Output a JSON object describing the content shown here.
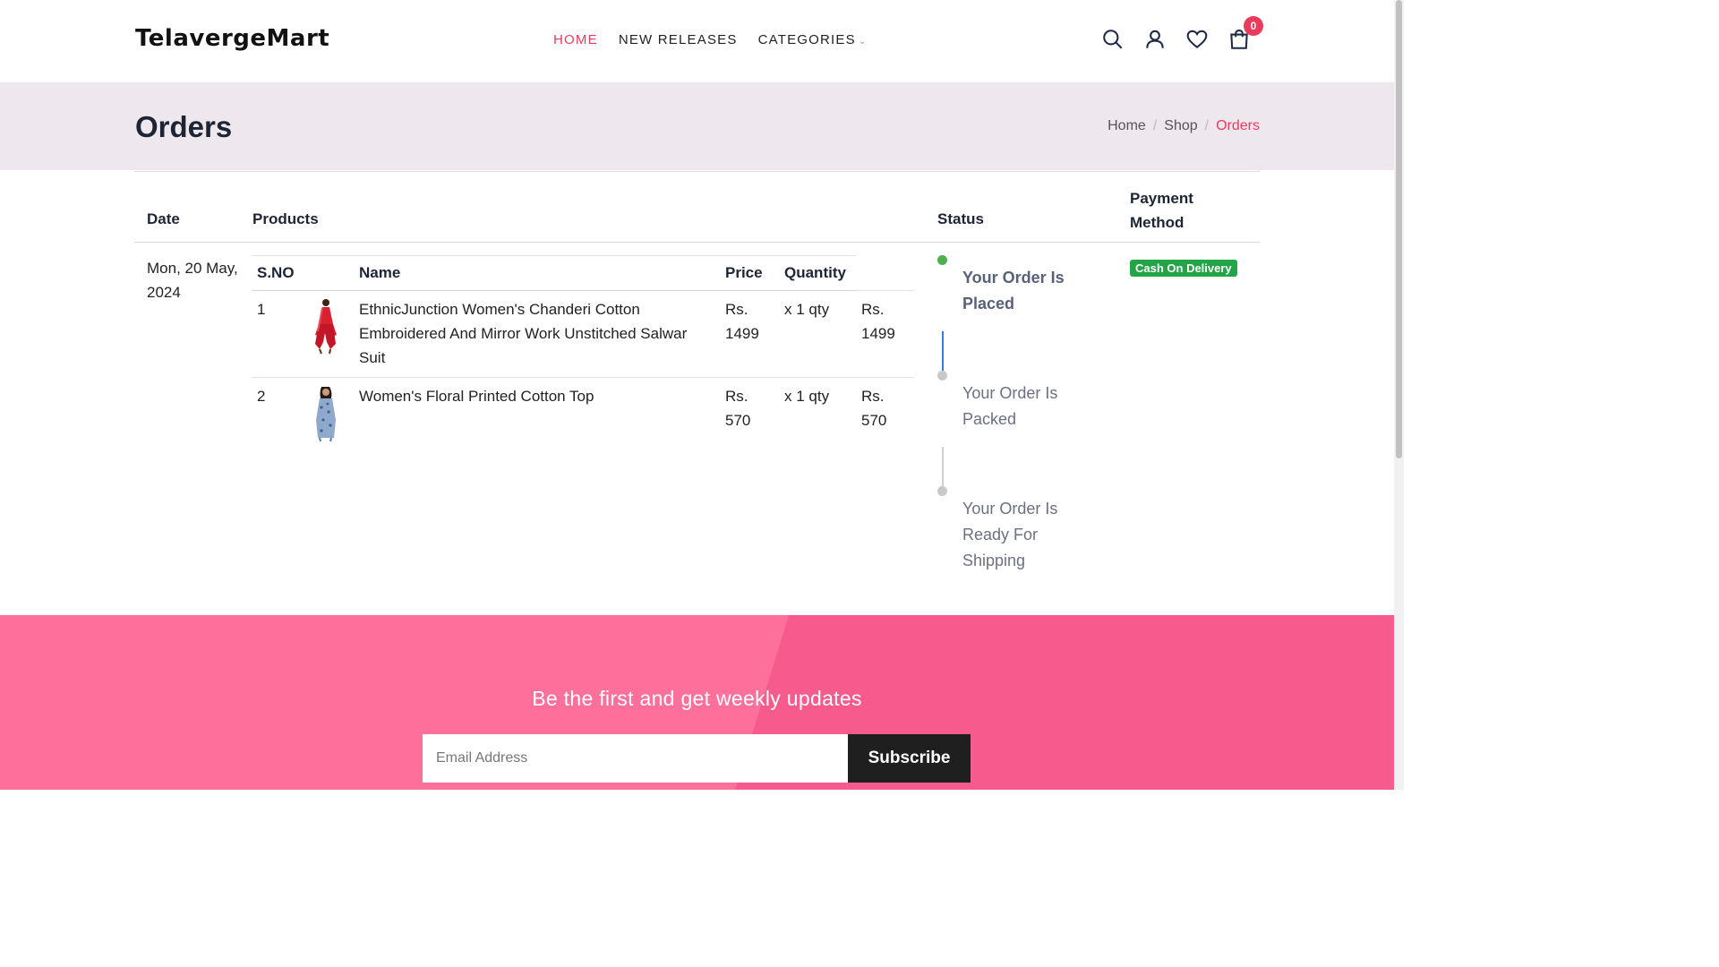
{
  "brand": {
    "logo": "TelavergeMart"
  },
  "nav": {
    "items": [
      {
        "label": "HOME",
        "active": true
      },
      {
        "label": "NEW RELEASES",
        "active": false
      },
      {
        "label": "CATEGORIES",
        "active": false
      }
    ],
    "chevron": "⌄"
  },
  "header_icons": {
    "search": "search-icon",
    "account": "user-icon",
    "wishlist": "heart-icon",
    "cart": "cart-icon",
    "cart_count": "0"
  },
  "page": {
    "title": "Orders"
  },
  "breadcrumb": {
    "items": [
      "Home",
      "Shop",
      "Orders"
    ],
    "separator": "/"
  },
  "orders_table": {
    "headers": {
      "date": "Date",
      "products": "Products",
      "status": "Status",
      "payment": "Payment Method"
    },
    "order": {
      "date": "Mon, 20 May, 2024",
      "product_headers": {
        "sno": "S.NO",
        "name": "Name",
        "price": "Price",
        "quantity": "Quantity"
      },
      "items": [
        {
          "sno": "1",
          "name": "EthnicJunction Women's Chanderi Cotton Embroidered And Mirror Work Unstitched Salwar Suit",
          "price": "Rs. 1499",
          "qty": "x 1 qty",
          "total": "Rs. 1499"
        },
        {
          "sno": "2",
          "name": "Women's Floral Printed Cotton Top",
          "price": "Rs. 570",
          "qty": "x 1 qty",
          "total": "Rs. 570"
        }
      ],
      "status_steps": [
        {
          "label": "Your Order Is Placed",
          "done": true
        },
        {
          "label": "Your Order Is Packed",
          "done": false
        },
        {
          "label": "Your Order Is Ready For Shipping",
          "done": false
        }
      ],
      "payment_method": "Cash On Delivery"
    }
  },
  "newsletter": {
    "title": "Be the first and get weekly updates",
    "email_placeholder": "Email Address",
    "button": "Subscribe"
  },
  "colors": {
    "accent": "#ec3a5c",
    "success": "#22a447",
    "newsletter": "#fe709c",
    "title_band": "#eee7ee"
  }
}
